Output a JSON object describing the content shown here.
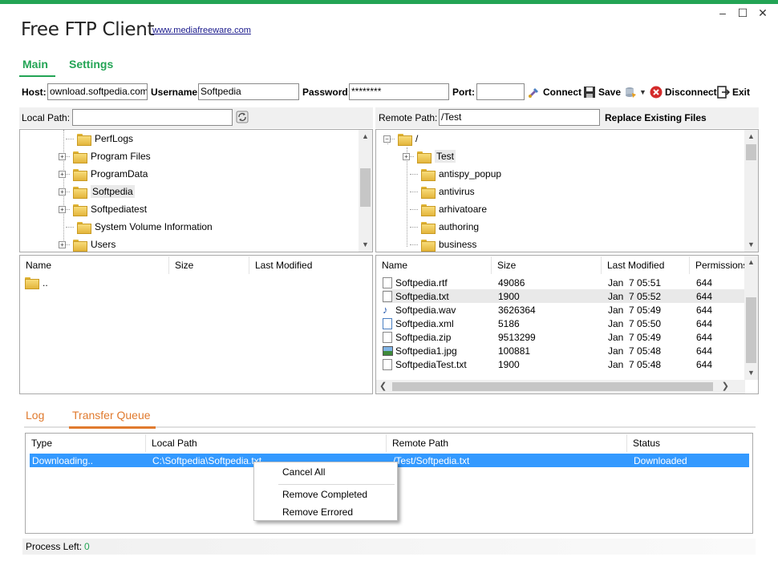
{
  "window": {
    "title": "Free FTP Client",
    "link": "www.mediafreeware.com",
    "minimize": "–",
    "maximize": "☐",
    "close": "✕",
    "accent": "#23a455"
  },
  "tabs": [
    {
      "label": "Main",
      "active": true
    },
    {
      "label": "Settings",
      "active": false
    }
  ],
  "connection": {
    "host_label": "Host:",
    "host_value": "ownload.softpedia.com",
    "username_label": "Username:",
    "username_value": "Softpedia",
    "password_label": "Password:",
    "password_value": "********",
    "port_label": "Port:",
    "port_value": ""
  },
  "toolbar": {
    "connect": "Connect",
    "save": "Save",
    "disconnect": "Disconnect",
    "exit": "Exit"
  },
  "local": {
    "path_label": "Local Path:",
    "path_value": "",
    "tree": [
      {
        "name": "PerfLogs",
        "expander": ""
      },
      {
        "name": "Program Files",
        "expander": "+"
      },
      {
        "name": "ProgramData",
        "expander": "+"
      },
      {
        "name": "Softpedia",
        "expander": "+",
        "selected": true
      },
      {
        "name": "Softpediatest",
        "expander": "+"
      },
      {
        "name": "System Volume Information",
        "expander": ""
      },
      {
        "name": "Users",
        "expander": "+"
      }
    ],
    "columns": [
      "Name",
      "Size",
      "Last Modified"
    ],
    "files": [
      {
        "name": ".."
      }
    ]
  },
  "remote": {
    "path_label": "Remote Path:",
    "path_value": "/Test",
    "replace_label": "Replace Existing Files",
    "tree": [
      {
        "name": "/",
        "expander": "−",
        "level": 0
      },
      {
        "name": "Test",
        "expander": "+",
        "level": 1,
        "selected": true
      },
      {
        "name": "antispy_popup",
        "expander": "",
        "level": 1
      },
      {
        "name": "antivirus",
        "expander": "",
        "level": 1
      },
      {
        "name": "arhivatoare",
        "expander": "",
        "level": 1
      },
      {
        "name": "authoring",
        "expander": "",
        "level": 1
      },
      {
        "name": "business",
        "expander": "",
        "level": 1
      }
    ],
    "columns": [
      "Name",
      "Size",
      "Last Modified",
      "Permissions"
    ],
    "files": [
      {
        "name": "Softpedia.rtf",
        "size": "49086",
        "modified": "Jan  7 05:51",
        "perm": "644",
        "icon": "rtf-file-icon"
      },
      {
        "name": "Softpedia.txt",
        "size": "1900",
        "modified": "Jan  7 05:52",
        "perm": "644",
        "icon": "text-file-icon",
        "selected": true
      },
      {
        "name": "Softpedia.wav",
        "size": "3626364",
        "modified": "Jan  7 05:49",
        "perm": "644",
        "icon": "audio-file-icon"
      },
      {
        "name": "Softpedia.xml",
        "size": "5186",
        "modified": "Jan  7 05:50",
        "perm": "644",
        "icon": "xml-file-icon"
      },
      {
        "name": "Softpedia.zip",
        "size": "9513299",
        "modified": "Jan  7 05:49",
        "perm": "644",
        "icon": "zip-file-icon"
      },
      {
        "name": "Softpedia1.jpg",
        "size": "100881",
        "modified": "Jan  7 05:48",
        "perm": "644",
        "icon": "image-file-icon"
      },
      {
        "name": "SoftpediaTest.txt",
        "size": "1900",
        "modified": "Jan  7 05:48",
        "perm": "644",
        "icon": "text-file-icon"
      }
    ]
  },
  "bottom_tabs": [
    {
      "label": "Log",
      "active": false
    },
    {
      "label": "Transfer Queue",
      "active": true
    }
  ],
  "queue": {
    "columns": [
      "Type",
      "Local Path",
      "Remote Path",
      "Status"
    ],
    "rows": [
      {
        "type": "Downloading..",
        "local": "C:\\Softpedia\\Softpedia.txt",
        "remote": "/Test/Softpedia.txt",
        "status": "Downloaded"
      }
    ]
  },
  "context_menu": [
    "Cancel All",
    "Remove Completed",
    "Remove Errored"
  ],
  "status": {
    "label": "Process Left:",
    "value": "0"
  }
}
